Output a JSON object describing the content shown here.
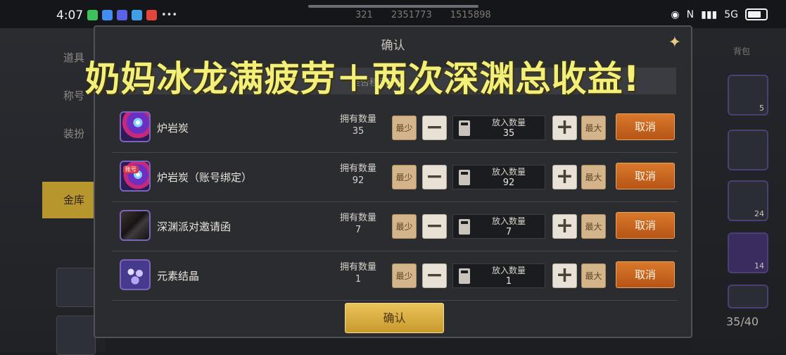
{
  "status_bar": {
    "time": "4:07",
    "resources": [
      "321",
      "2351773",
      "1515898"
    ],
    "signal": "5G"
  },
  "background": {
    "left_menu": [
      "道具",
      "称号",
      "装扮",
      "金库"
    ],
    "right_header": "背包",
    "right_counts": [
      "5",
      "24",
      "14"
    ],
    "page_indicator": "35/40"
  },
  "dialog": {
    "title": "确认",
    "hint": "是否移动2件",
    "confirm_label": "确认",
    "items": [
      {
        "name": "炉岩炭",
        "own_label": "拥有数量",
        "own_count": "35",
        "put_label": "放入数量",
        "put_count": "35",
        "min_label": "最少",
        "max_label": "最大",
        "cancel_label": "取消",
        "icon": "fire-coal-icon",
        "bound": false
      },
      {
        "name": "炉岩炭（账号绑定）",
        "own_label": "拥有数量",
        "own_count": "92",
        "put_label": "放入数量",
        "put_count": "92",
        "min_label": "最少",
        "max_label": "最大",
        "cancel_label": "取消",
        "icon": "bound-fire-coal-icon",
        "bound": true,
        "bound_tag": "账号"
      },
      {
        "name": "深渊派对邀请函",
        "own_label": "拥有数量",
        "own_count": "7",
        "put_label": "放入数量",
        "put_count": "7",
        "min_label": "最少",
        "max_label": "最大",
        "cancel_label": "取消",
        "icon": "abyss-invitation-icon",
        "bound": false
      },
      {
        "name": "元素结晶",
        "own_label": "拥有数量",
        "own_count": "1",
        "put_label": "放入数量",
        "put_count": "1",
        "min_label": "最少",
        "max_label": "最大",
        "cancel_label": "取消",
        "icon": "element-crystal-icon",
        "bound": false
      }
    ]
  },
  "overlay_caption": "奶妈冰龙满疲劳＋两次深渊总收益!",
  "colors": {
    "accent_gold": "#e9c35b",
    "cancel_orange": "#d9792b",
    "caption_yellow": "#f4ef78"
  }
}
